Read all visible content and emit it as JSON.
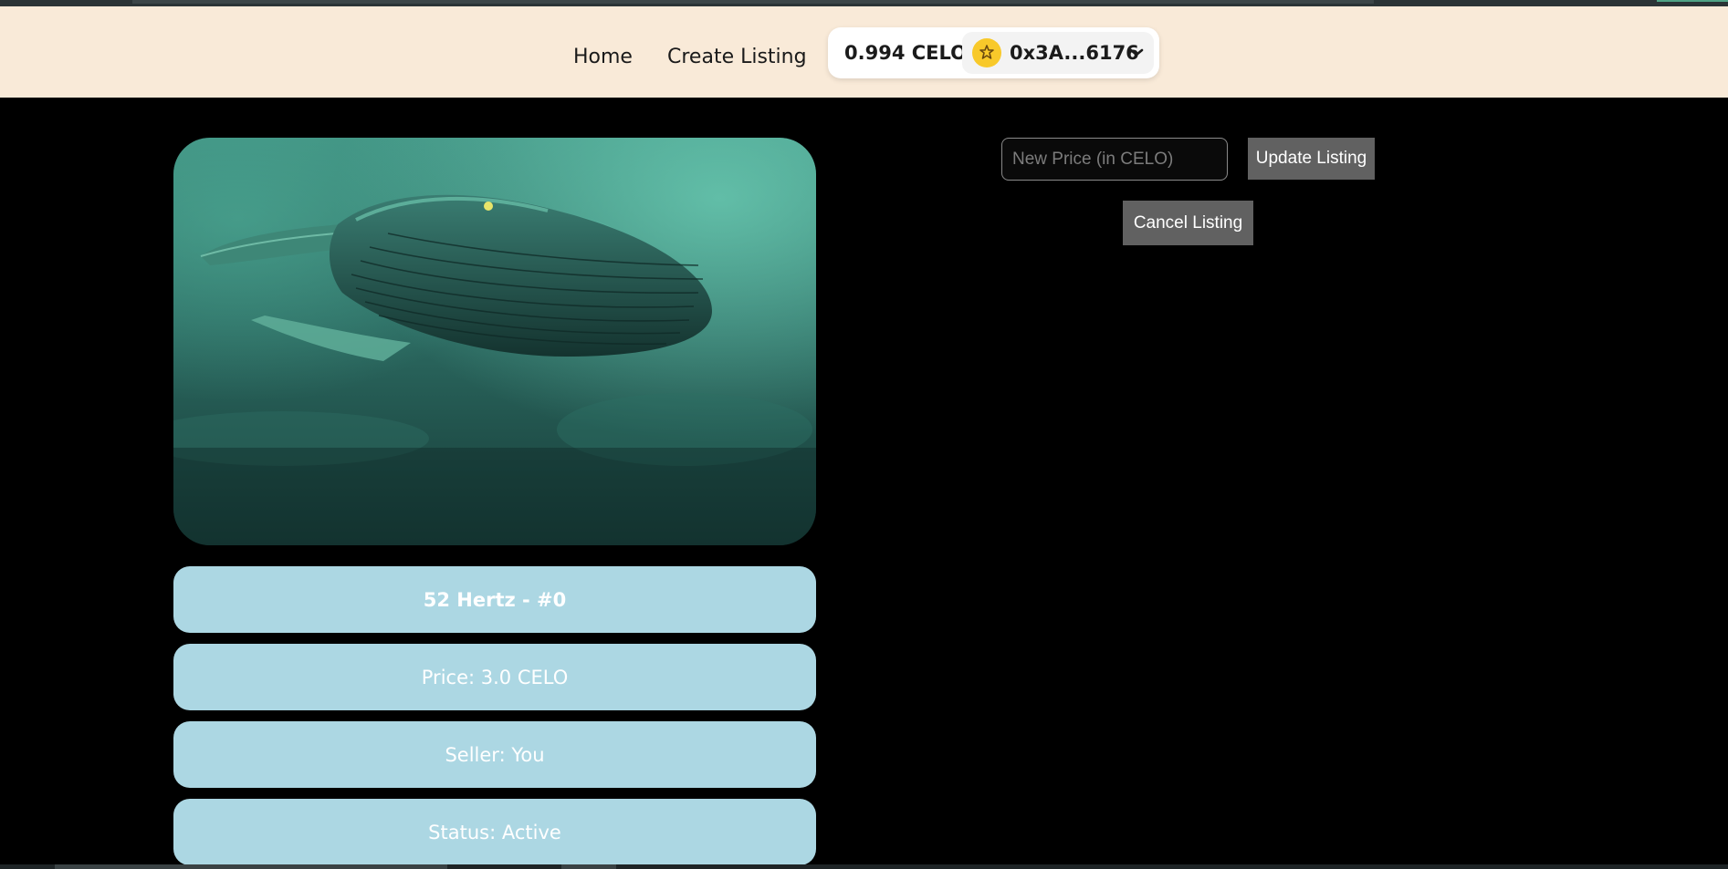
{
  "nav": {
    "home_label": "Home",
    "create_label": "Create Listing"
  },
  "wallet": {
    "balance": "0.994 CELO",
    "address": "0x3A...6176",
    "avatar_icon": "emoji-avatar-icon",
    "avatar_color": "#f8c92a"
  },
  "nft": {
    "image_alt": "whale-painting",
    "name": "52 Hertz - #0",
    "price": "Price: 3.0 CELO",
    "seller": "Seller: You",
    "status": "Status: Active"
  },
  "actions": {
    "new_price_placeholder": "New Price (in CELO)",
    "update_label": "Update Listing",
    "cancel_label": "Cancel Listing"
  },
  "colors": {
    "navbar_bg": "#f9ead8",
    "card_bg": "#acd7e3",
    "button_bg": "#616161"
  }
}
